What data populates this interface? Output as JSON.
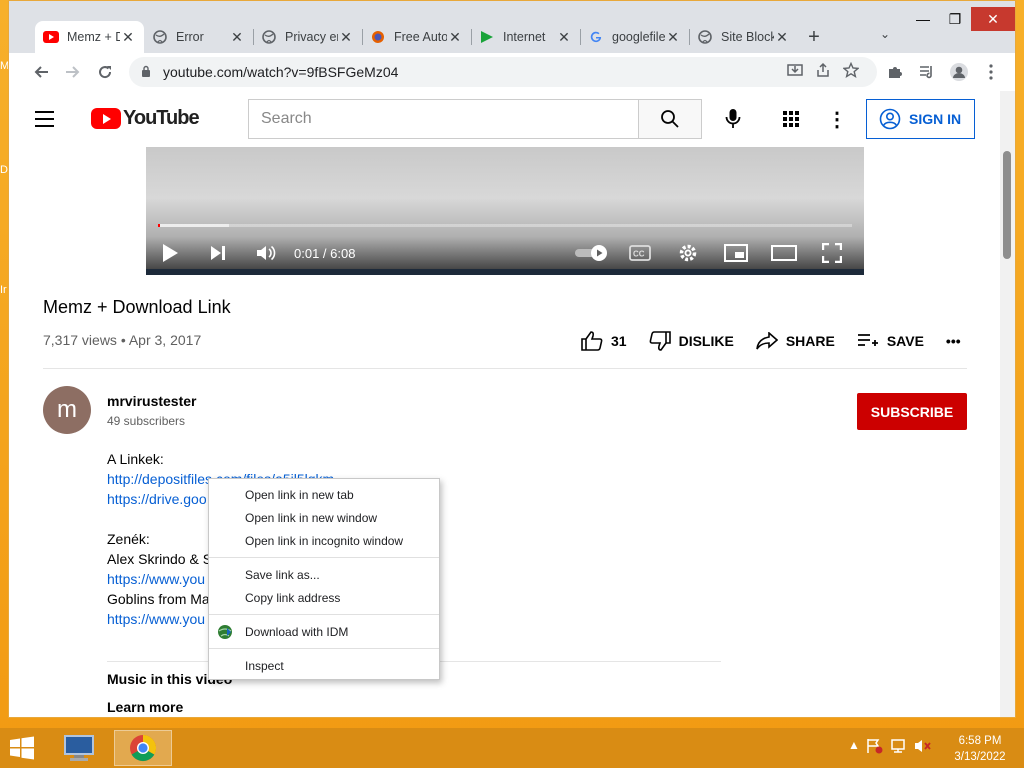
{
  "desktop": {
    "labels": [
      "M",
      "D",
      "Ir"
    ]
  },
  "window": {
    "minimize": "—",
    "maximize": "❐",
    "close": "✕"
  },
  "tabs": [
    {
      "title": "Memz + Download Link",
      "favicon": "youtube-icon",
      "active": true,
      "close": "✕"
    },
    {
      "title": "Error",
      "favicon": "globe-icon",
      "close": "✕"
    },
    {
      "title": "Privacy error",
      "favicon": "globe-icon",
      "close": "✕"
    },
    {
      "title": "Free Auto Clicker",
      "favicon": "firefox-icon",
      "close": "✕"
    },
    {
      "title": "Internet",
      "favicon": "play-green-icon",
      "close": "✕"
    },
    {
      "title": "googlefiles",
      "favicon": "google-icon",
      "close": "✕"
    },
    {
      "title": "Site Blocked",
      "favicon": "globe-icon",
      "close": "✕"
    }
  ],
  "newtab": "+",
  "tabsearch": "⌄",
  "toolbar": {
    "url": "youtube.com/watch?v=9fBSFGeMz04"
  },
  "youtube": {
    "logo_text": "YouTube",
    "search_placeholder": "Search",
    "sign_in": "SIGN IN",
    "more": "⋮"
  },
  "player": {
    "time": "0:01 / 6:08",
    "progress": 0.003,
    "buffered": 0.1
  },
  "video": {
    "title": "Memz + Download Link",
    "meta": "7,317 views • Apr 3, 2017",
    "likes": "31",
    "dislike": "DISLIKE",
    "share": "SHARE",
    "save": "SAVE",
    "more": "•••"
  },
  "channel": {
    "avatar_letter": "m",
    "name": "mrvirustester",
    "subscribers": "49 subscribers",
    "subscribe": "SUBSCRIBE"
  },
  "description": {
    "lines": [
      {
        "text": "A Linkek:",
        "link": false
      },
      {
        "text": "http://depositfiles.com/files/a5il5lqkm",
        "link": true
      },
      {
        "text": "https://drive.goo",
        "link": true
      },
      {
        "text": "",
        "link": false
      },
      {
        "text": "Zenék:",
        "link": false
      },
      {
        "text": "Alex Skrindo & S",
        "link": false
      },
      {
        "text": "https://www.you",
        "link": true
      },
      {
        "text": "Goblins from Ma",
        "link": false
      },
      {
        "text": "https://www.you",
        "link": true
      }
    ],
    "music_header": "Music in this video",
    "learn_more": "Learn more"
  },
  "context_menu": {
    "group1": [
      "Open link in new tab",
      "Open link in new window",
      "Open link in incognito window"
    ],
    "group2": [
      "Save link as...",
      "Copy link address"
    ],
    "group3": [
      "Download with IDM"
    ],
    "group4": [
      "Inspect"
    ]
  },
  "taskbar": {
    "time": "6:58 PM",
    "date": "3/13/2022"
  },
  "colors": {
    "youtube_red": "#ff0000",
    "subscribe_red": "#cc0000",
    "link_blue": "#065fd4",
    "taskbar": "#d98c14"
  }
}
